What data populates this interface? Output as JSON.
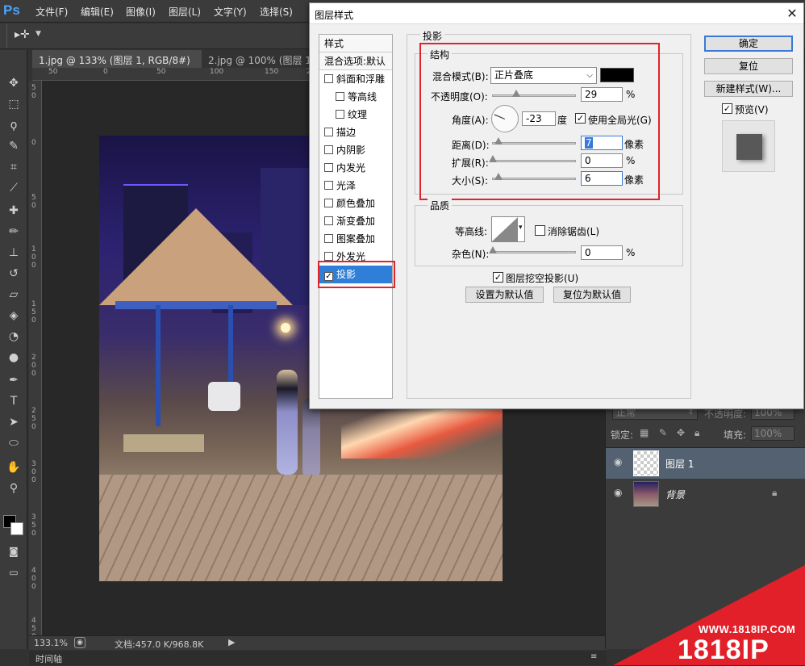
{
  "app": {
    "logo": "Ps"
  },
  "menu": [
    "文件(F)",
    "编辑(E)",
    "图像(I)",
    "图层(L)",
    "文字(Y)",
    "选择(S)"
  ],
  "tabs": [
    "1.jpg @ 133% (图层 1, RGB/8#) *",
    "2.jpg @ 100% (图层 1,"
  ],
  "ruler_top": [
    "50",
    "0",
    "50",
    "100",
    "150",
    "200",
    "250"
  ],
  "ruler_left": [
    "5 0",
    "0",
    "5 0",
    "1 0 0",
    "1 5 0",
    "2 0 0",
    "2 5 0",
    "3 0 0",
    "3 5 0",
    "4 0 0",
    "4 5 0"
  ],
  "status": {
    "zoom": "133.1%",
    "doc": "文档:457.0 K/968.8K",
    "timeline": "时间轴"
  },
  "layers": {
    "blend_mode": "正常",
    "opacity_label": "不透明度:",
    "opacity_value": "100%",
    "lock_label": "锁定:",
    "fill_label": "填充:",
    "fill_value": "100%",
    "items": [
      {
        "name": "图层 1"
      },
      {
        "name": "背景"
      }
    ]
  },
  "dialog": {
    "title": "图层样式",
    "close": "✕",
    "styles": [
      {
        "label": "样式",
        "checkbox": false
      },
      {
        "label": "混合选项:默认",
        "checkbox": false
      },
      {
        "label": "斜面和浮雕",
        "checkbox": true,
        "checked": false
      },
      {
        "label": "等高线",
        "checkbox": true,
        "checked": false,
        "indent": true
      },
      {
        "label": "纹理",
        "checkbox": true,
        "checked": false,
        "indent": true
      },
      {
        "label": "描边",
        "checkbox": true,
        "checked": false
      },
      {
        "label": "内阴影",
        "checkbox": true,
        "checked": false
      },
      {
        "label": "内发光",
        "checkbox": true,
        "checked": false
      },
      {
        "label": "光泽",
        "checkbox": true,
        "checked": false
      },
      {
        "label": "颜色叠加",
        "checkbox": true,
        "checked": false
      },
      {
        "label": "渐变叠加",
        "checkbox": true,
        "checked": false
      },
      {
        "label": "图案叠加",
        "checkbox": true,
        "checked": false
      },
      {
        "label": "外发光",
        "checkbox": true,
        "checked": false
      },
      {
        "label": "投影",
        "checkbox": true,
        "checked": true,
        "selected": true
      }
    ],
    "section_title": "投影",
    "structure": {
      "title": "结构",
      "blend_mode_label": "混合模式(B):",
      "blend_mode_value": "正片叠底",
      "shadow_color": "#000000",
      "opacity_label": "不透明度(O):",
      "opacity_value": "29",
      "opacity_unit": "%",
      "opacity_fraction": 0.29,
      "angle_label": "角度(A):",
      "angle_value": "-23",
      "angle_unit": "度",
      "global_light_label": "使用全局光(G)",
      "global_light_checked": true,
      "distance_label": "距离(D):",
      "distance_value": "7",
      "distance_unit": "像素",
      "spread_label": "扩展(R):",
      "spread_value": "0",
      "spread_unit": "%",
      "size_label": "大小(S):",
      "size_value": "6",
      "size_unit": "像素"
    },
    "quality": {
      "title": "品质",
      "contour_label": "等高线:",
      "antialias_label": "消除锯齿(L)",
      "antialias_checked": false,
      "noise_label": "杂色(N):",
      "noise_value": "0",
      "noise_unit": "%"
    },
    "knockout_label": "图层挖空投影(U)",
    "knockout_checked": true,
    "make_default": "设置为默认值",
    "reset_default": "复位为默认值",
    "buttons": {
      "ok": "确定",
      "reset": "复位",
      "new_style": "新建样式(W)...",
      "preview": "预览(V)"
    },
    "preview_checked": true
  },
  "watermark": {
    "url": "WWW.1818IP.COM",
    "brand": "1818IP"
  }
}
